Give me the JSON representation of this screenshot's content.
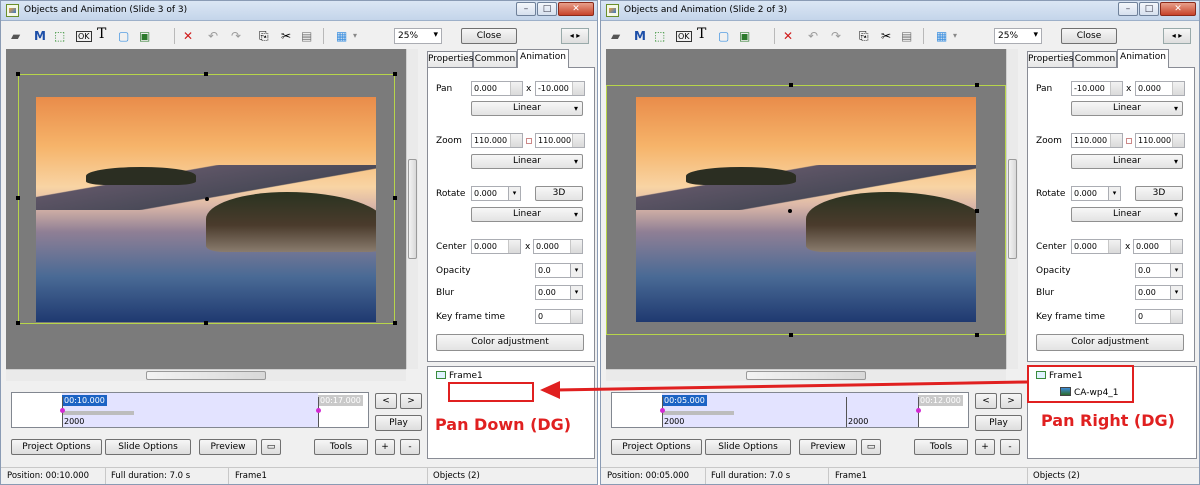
{
  "accent_color": "#e02020",
  "window_left": {
    "title": "Objects and Animation  (Slide 3 of 3)",
    "zoom": "25%",
    "close_label": "Close",
    "tabs": [
      "Properties",
      "Common",
      "Animation"
    ],
    "pan": {
      "label": "Pan",
      "x": "0.000",
      "sep": "x",
      "y": "-10.000",
      "interp": "Linear"
    },
    "zoom_prop": {
      "label": "Zoom",
      "x": "110.000",
      "y": "110.000",
      "interp": "Linear"
    },
    "rotate": {
      "label": "Rotate",
      "value": "0.000",
      "btn3d": "3D",
      "interp": "Linear"
    },
    "center": {
      "label": "Center",
      "x": "0.000",
      "sep": "x",
      "y": "0.000"
    },
    "opacity": {
      "label": "Opacity",
      "value": "0.0"
    },
    "blur": {
      "label": "Blur",
      "value": "0.00"
    },
    "keyframe": {
      "label": "Key frame time",
      "value": "0"
    },
    "color_adj": "Color adjustment",
    "tree": {
      "frame": "Frame1"
    },
    "timeline": {
      "start": "00:10.000",
      "end": "00:17.000",
      "num": "2000"
    },
    "play": "Play",
    "buttons": {
      "project": "Project Options",
      "slide": "Slide Options",
      "preview": "Preview",
      "tools": "Tools"
    },
    "status": {
      "position": "Position:  00:10.000",
      "duration": "Full duration:  7.0 s",
      "frame": "Frame1",
      "objects": "Objects (2)"
    },
    "annotation": "Pan Down (DG)"
  },
  "window_right": {
    "title": "Objects and Animation  (Slide 2 of 3)",
    "zoom": "25%",
    "close_label": "Close",
    "tabs": [
      "Properties",
      "Common",
      "Animation"
    ],
    "pan": {
      "label": "Pan",
      "x": "-10.000",
      "sep": "x",
      "y": "0.000",
      "interp": "Linear"
    },
    "zoom_prop": {
      "label": "Zoom",
      "x": "110.000",
      "y": "110.000",
      "interp": "Linear"
    },
    "rotate": {
      "label": "Rotate",
      "value": "0.000",
      "btn3d": "3D",
      "interp": "Linear"
    },
    "center": {
      "label": "Center",
      "x": "0.000",
      "sep": "x",
      "y": "0.000"
    },
    "opacity": {
      "label": "Opacity",
      "value": "0.0"
    },
    "blur": {
      "label": "Blur",
      "value": "0.00"
    },
    "keyframe": {
      "label": "Key frame time",
      "value": "0"
    },
    "color_adj": "Color adjustment",
    "tree": {
      "frame": "Frame1",
      "child": "CA-wp4_1"
    },
    "timeline": {
      "start": "00:05.000",
      "end": "00:12.000",
      "num": "2000",
      "num2": "2000"
    },
    "play": "Play",
    "buttons": {
      "project": "Project Options",
      "slide": "Slide Options",
      "preview": "Preview",
      "tools": "Tools"
    },
    "status": {
      "position": "Position:  00:05.000",
      "duration": "Full duration:  7.0 s",
      "frame": "Frame1",
      "objects": "Objects (2)"
    },
    "annotation": "Pan Right (DG)"
  }
}
